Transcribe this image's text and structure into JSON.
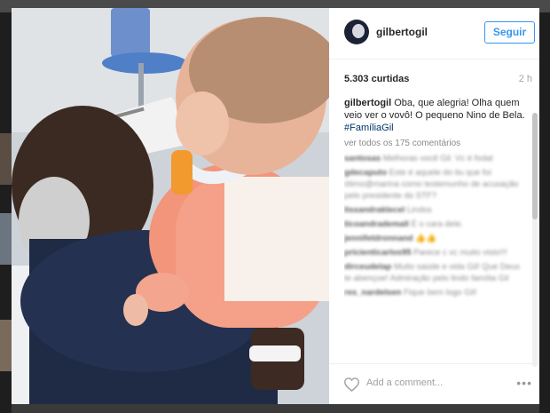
{
  "background": {
    "username_partial": "gilbertogil"
  },
  "post": {
    "username": "gilbertogil",
    "follow_label": "Seguir",
    "likes": "5.303 curtidas",
    "time": "2 h",
    "caption_user": "gilbertogil",
    "caption_text": "Oba, que alegria! Olha quem veio ver o vovô! O pequeno Nino de Bela.",
    "hashtag": "#FamíliaGil",
    "view_all": "ver todos os 175 comentários",
    "comments": [
      {
        "user": "santosas",
        "text": "Melhoras você Gil. Vc é fodal"
      },
      {
        "user": "gdecaputo",
        "text": "Este é aquele do tiu que foi ótimo@marina como testemunho de acusação pelo presidente do STF?"
      },
      {
        "user": "lissandraklecel",
        "text": "Lindos"
      },
      {
        "user": "ticoandrademall",
        "text": "É o cara dele."
      },
      {
        "user": "jennifetdronnand",
        "text": "👍👍"
      },
      {
        "user": "pricienticarlos95",
        "text": "Parece c vc muito visto!!!"
      },
      {
        "user": "dirceudelap",
        "text": "Muito saúde e vida Gil! Que Deus te abençoe! Admiração pelo lindo família Gil"
      },
      {
        "user": "res_nardelsen",
        "text": "Fique bem logo Gil!"
      }
    ],
    "add_comment_placeholder": "Add a comment...",
    "more_label": "•••"
  },
  "icons": {
    "heart": "heart-icon",
    "more": "more-options-icon"
  },
  "colors": {
    "accent": "#3897f0",
    "hashtag": "#003569"
  }
}
